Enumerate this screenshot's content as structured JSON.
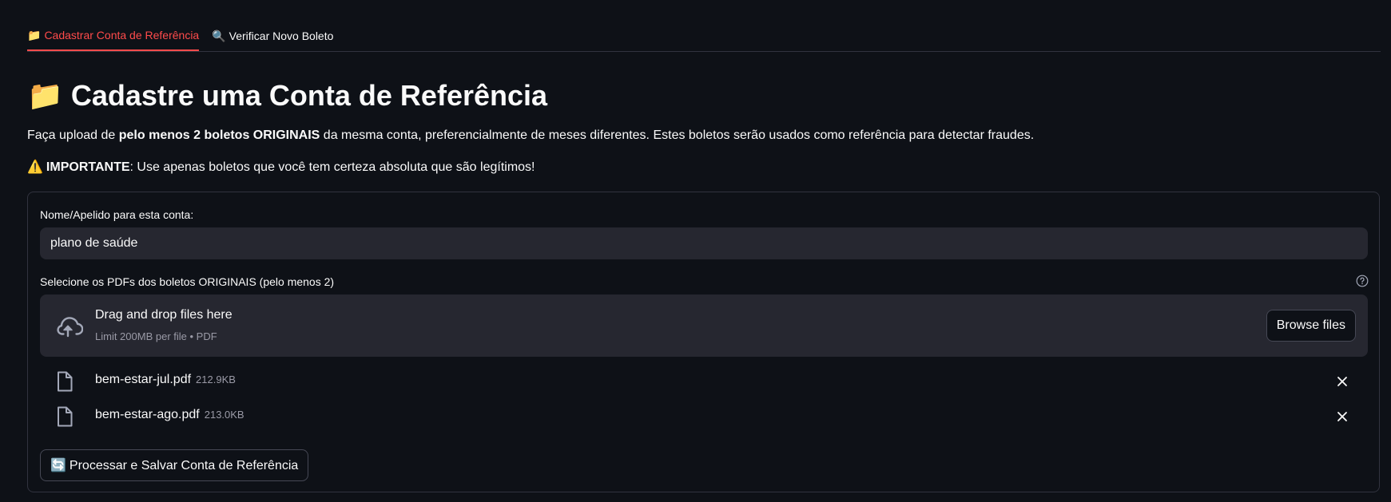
{
  "tabs": [
    {
      "icon": "📁",
      "icon_name": "folder-icon",
      "label": "Cadastrar Conta de Referência",
      "active": true
    },
    {
      "icon": "🔍",
      "icon_name": "magnifier-icon",
      "label": "Verificar Novo Boleto",
      "active": false
    }
  ],
  "header": {
    "icon": "📁",
    "title": "Cadastre uma Conta de Referência"
  },
  "intro": {
    "prefix": "Faça upload de ",
    "bold": "pelo menos 2 boletos ORIGINAIS",
    "suffix": " da mesma conta, preferencialmente de meses diferentes. Estes boletos serão usados como referência para detectar fraudes."
  },
  "warning": {
    "icon": "⚠️",
    "bold": "IMPORTANTE",
    "text": ": Use apenas boletos que você tem certeza absoluta que são legítimos!"
  },
  "form": {
    "name_label": "Nome/Apelido para esta conta:",
    "name_value": "plano de saúde",
    "files_label": "Selecione os PDFs dos boletos ORIGINAIS (pelo menos 2)",
    "dropzone_title": "Drag and drop files here",
    "dropzone_limit": "Limit 200MB per file • PDF",
    "browse_label": "Browse files",
    "files": [
      {
        "name": "bem-estar-jul.pdf",
        "size": "212.9KB"
      },
      {
        "name": "bem-estar-ago.pdf",
        "size": "213.0KB"
      }
    ],
    "submit_icon": "🔄",
    "submit_label": "Processar e Salvar Conta de Referência"
  },
  "colors": {
    "background": "#0e1117",
    "accent": "#ff4b4b",
    "input_bg": "#262730",
    "border": "#31333f",
    "muted_text": "#9a9aa6"
  }
}
